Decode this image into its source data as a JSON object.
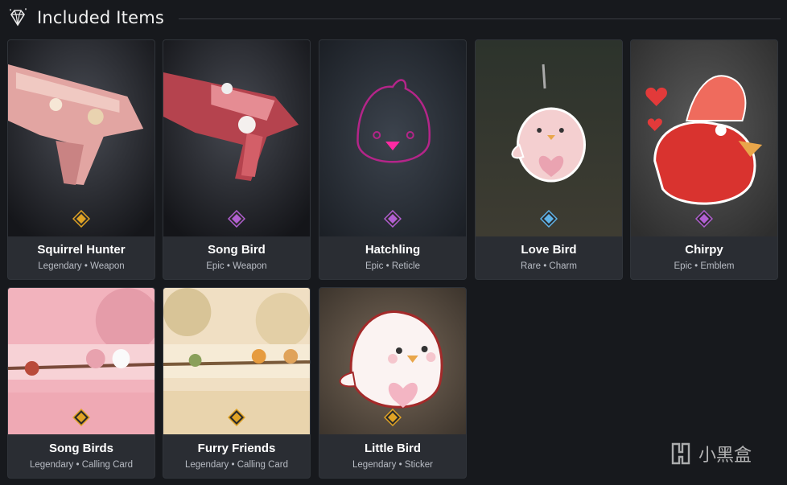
{
  "header": {
    "title": "Included Items",
    "icon": "diamond-icon"
  },
  "rarity_colors": {
    "Legendary": "#e0a325",
    "Epic": "#b15fd1",
    "Rare": "#5fb3e8"
  },
  "items": [
    {
      "name": "Squirrel Hunter",
      "rarity": "Legendary",
      "dot": "•",
      "type": "Weapon"
    },
    {
      "name": "Song Bird",
      "rarity": "Epic",
      "dot": "•",
      "type": "Weapon"
    },
    {
      "name": "Hatchling",
      "rarity": "Epic",
      "dot": "•",
      "type": "Reticle"
    },
    {
      "name": "Love Bird",
      "rarity": "Rare",
      "dot": "•",
      "type": "Charm"
    },
    {
      "name": "Chirpy",
      "rarity": "Epic",
      "dot": "•",
      "type": "Emblem"
    },
    {
      "name": "Song Birds",
      "rarity": "Legendary",
      "dot": "•",
      "type": "Calling Card"
    },
    {
      "name": "Furry Friends",
      "rarity": "Legendary",
      "dot": "•",
      "type": "Calling Card"
    },
    {
      "name": "Little Bird",
      "rarity": "Legendary",
      "dot": "•",
      "type": "Sticker"
    }
  ],
  "watermark": {
    "text": "小黑盒"
  }
}
